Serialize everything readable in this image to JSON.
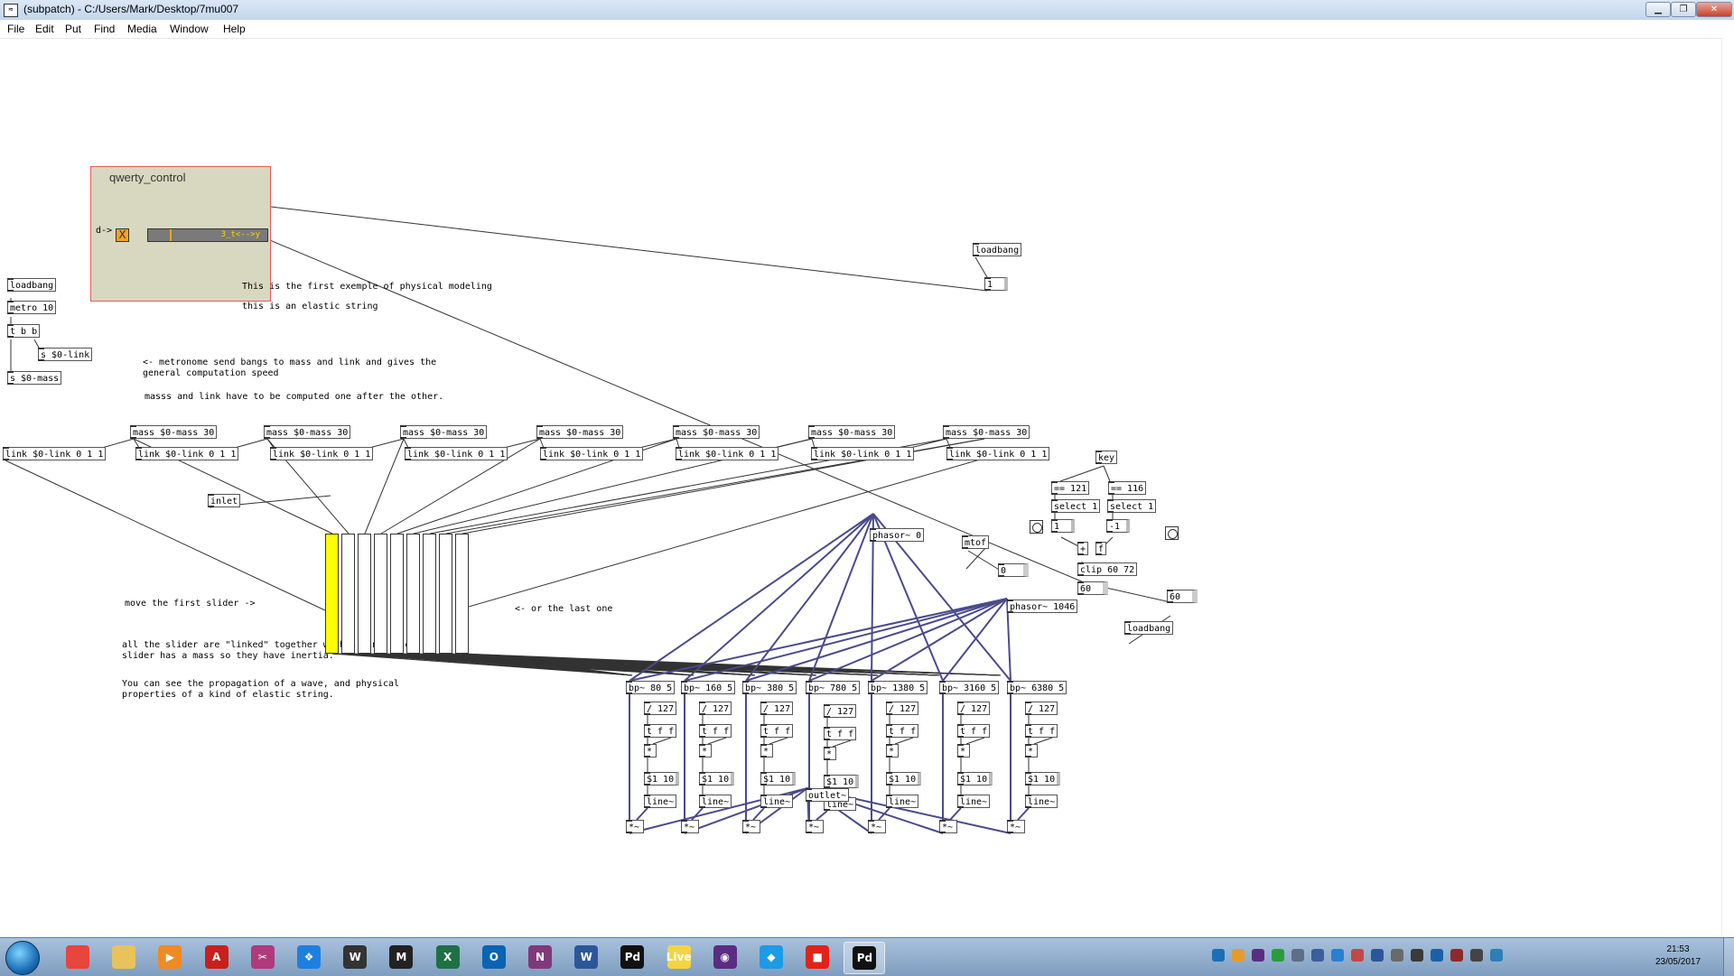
{
  "window": {
    "title": "(subpatch)  - C:/Users/Mark/Desktop/7mu007",
    "buttons": {
      "minimize": "▁",
      "maximize": "❐",
      "close": "✕"
    }
  },
  "menu": [
    "File",
    "Edit",
    "Put",
    "Find",
    "Media",
    "Window",
    "Help"
  ],
  "gop": {
    "label": "qwerty_control",
    "d_label": "d->",
    "toggle_mark": "X",
    "slider_label": "3_t<-->y"
  },
  "objects": {
    "loadbang_left": "loadbang",
    "metro": "metro 10",
    "tbb": "t b b",
    "s_link": "s $0-link",
    "s_mass": "s $0-mass",
    "loadbang_right": "loadbang",
    "msg_one": "1",
    "inlet": "inlet",
    "key": "key",
    "eq121": "== 121",
    "eq116": "== 116",
    "sel1a": "select 1",
    "sel1b": "select 1",
    "msg_1": "1",
    "msg_m1": "-1",
    "plus": "+",
    "f": "f",
    "clip": "clip 60 72",
    "num60a": "60",
    "num60b": "60",
    "loadbang_bottom": "loadbang",
    "phasor0": "phasor~ 0",
    "mtof": "mtof",
    "num0": "0",
    "phasor1046": "phasor~ 1046",
    "outlet": "outlet~"
  },
  "masses": [
    "mass $0-mass 30",
    "mass $0-mass 30",
    "mass $0-mass 30",
    "mass $0-mass 30",
    "mass $0-mass 30",
    "mass $0-mass 30",
    "mass $0-mass 30"
  ],
  "links": [
    "link $0-link 0 1 1",
    "link $0-link 0 1 1",
    "link $0-link 0 1 1",
    "link $0-link 0 1 1",
    "link $0-link 0 1 1",
    "link $0-link 0 1 1",
    "link $0-link 0 1 1",
    "link $0-link 0 1 1"
  ],
  "filters": [
    "bp~ 80 5",
    "bp~ 160 5",
    "bp~ 380 5",
    "bp~ 780 5",
    "bp~ 1380 5",
    "bp~ 3160 5",
    "bp~ 6380 5"
  ],
  "chain": {
    "div": "/ 127",
    "tff": "t f f",
    "mul": "*",
    "msg": "$1 10",
    "line": "line~",
    "mulsig": "*~"
  },
  "comments": {
    "c1": "This is the first exemple of physical modeling",
    "c2": "this is an elastic string",
    "c3": "<- metronome send bangs to mass and link and gives the\ngeneral computation speed",
    "c4": "masss and link have to be computed one after the other.",
    "c5": "move the first slider ->",
    "c6": "<- or the last one",
    "c7": "all the slider are \"linked\" together with a link. Each\nslider has a mass so they have inertia.",
    "c8": "You can see the propagation of a wave, and physical\nproperties of a kind of elastic string."
  },
  "sliders": {
    "count": 9,
    "first_fill": 1.0,
    "fill_color": "#ffff00"
  },
  "colors": {
    "signal_wire": "#4a4a8c",
    "control_wire": "#333333",
    "gop_bg": "#d8d8c0",
    "gop_border": "#e85a5a"
  },
  "taskbar": {
    "apps": [
      {
        "name": "chrome",
        "glyph": "",
        "color": "#e8453c"
      },
      {
        "name": "explorer",
        "glyph": "",
        "color": "#e8c25a"
      },
      {
        "name": "media-player",
        "glyph": "▶",
        "color": "#f08a24"
      },
      {
        "name": "acrobat",
        "glyph": "A",
        "color": "#c8201c"
      },
      {
        "name": "snipping",
        "glyph": "✂",
        "color": "#b03a7a"
      },
      {
        "name": "dropbox",
        "glyph": "❖",
        "color": "#1f7fe0"
      },
      {
        "name": "waves",
        "glyph": "W",
        "color": "#333333"
      },
      {
        "name": "max",
        "glyph": "M",
        "color": "#222222"
      },
      {
        "name": "excel",
        "glyph": "X",
        "color": "#1e7145"
      },
      {
        "name": "outlook",
        "glyph": "O",
        "color": "#0a64b4"
      },
      {
        "name": "onenote",
        "glyph": "N",
        "color": "#80397b"
      },
      {
        "name": "word",
        "glyph": "W",
        "color": "#2b579a"
      },
      {
        "name": "pd",
        "glyph": "Pd",
        "color": "#111111"
      },
      {
        "name": "live",
        "glyph": "Live",
        "color": "#f4d443"
      },
      {
        "name": "eye-app",
        "glyph": "◉",
        "color": "#5a2d82"
      },
      {
        "name": "blue-app",
        "glyph": "◆",
        "color": "#1c9be6"
      },
      {
        "name": "roblox",
        "glyph": "■",
        "color": "#e2231a"
      },
      {
        "name": "pd-active",
        "glyph": "Pd",
        "color": "#111111"
      }
    ],
    "time": "21:53",
    "date": "23/05/2017"
  }
}
